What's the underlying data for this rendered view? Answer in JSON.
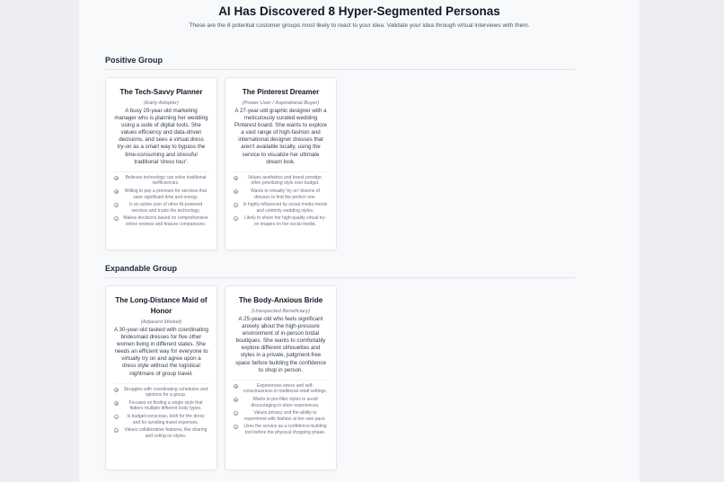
{
  "header": {
    "title": "AI Has Discovered 8 Hyper-Segmented Personas",
    "subtitle": "These are the 8 potential customer groups most likely to react to your idea. Validate your idea through virtual interviews with them."
  },
  "groups": [
    {
      "label": "Positive Group",
      "personas": [
        {
          "name": "The Tech-Savvy Planner",
          "tag": "(Early Adopter)",
          "description": "A busy 29-year-old marketing manager who is planning her wedding using a suite of digital tools. She values efficiency and data-driven decisions, and sees a virtual dress try-on as a smart way to bypass the time-consuming and stressful traditional 'dress tour'.",
          "points": [
            "Believes technology can solve traditional inefficiencies.",
            "Willing to pay a premium for services that save significant time and energy.",
            "Is an active user of other AI-powered services and trusts the technology.",
            "Makes decisions based on comprehensive online reviews and feature comparisons."
          ]
        },
        {
          "name": "The Pinterest Dreamer",
          "tag": "(Power User / Aspirational Buyer)",
          "description": "A 27-year-old graphic designer with a meticulously curated wedding Pinterest board. She wants to explore a vast range of high-fashion and international designer dresses that aren't available locally, using the service to visualize her ultimate dream look.",
          "points": [
            "Values aesthetics and brand prestige, often prioritizing style over budget.",
            "Wants to virtually 'try on' dozens of dresses to find the perfect one.",
            "Is highly influenced by social media trends and celebrity wedding styles.",
            "Likely to share her high-quality virtual try-on images on her social media."
          ]
        }
      ]
    },
    {
      "label": "Expandable Group",
      "personas": [
        {
          "name": "The Long-Distance Maid of Honor",
          "tag": "(Adjacent Market)",
          "description": "A 30-year-old tasked with coordinating bridesmaid dresses for five other women living in different states. She needs an efficient way for everyone to virtually try on and agree upon a dress style without the logistical nightmare of group travel.",
          "points": [
            "Struggles with coordinating schedules and opinions for a group.",
            "Focuses on finding a single style that flatters multiple different body types.",
            "Is budget-conscious, both for the dress and for avoiding travel expenses.",
            "Values collaborative features, like sharing and voting on styles."
          ]
        },
        {
          "name": "The Body-Anxious Bride",
          "tag": "(Unexpected Beneficiary)",
          "description": "A 25-year-old who feels significant anxiety about the high-pressure environment of in-person bridal boutiques. She wants to comfortably explore different silhouettes and styles in a private, judgment-free space before building the confidence to shop in person.",
          "points": [
            "Experiences stress and self-consciousness in traditional retail settings.",
            "Wants to pre-filter styles to avoid discouraging in-store experiences.",
            "Values privacy and the ability to experiment with fashion at her own pace.",
            "Uses the service as a confidence-building tool before the physical shopping phase."
          ]
        }
      ]
    }
  ]
}
